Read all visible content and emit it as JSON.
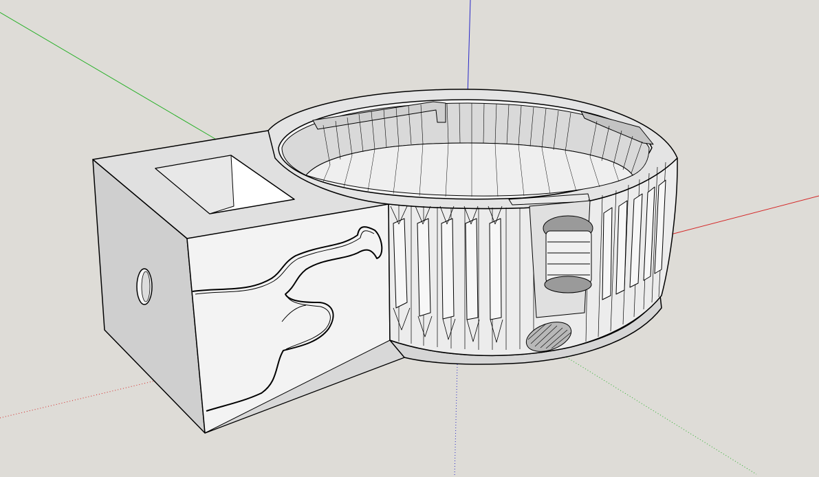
{
  "viewport": {
    "background": "#dedcd7"
  },
  "axes": {
    "red": "#d42424",
    "green": "#26b026",
    "blue": "#2626c8"
  },
  "model": {
    "face_light": "#f2f2f2",
    "face_mid": "#e1e1e1",
    "face_dark": "#cbcbcb",
    "face_darker": "#b5b5b5",
    "edge": "#000000"
  }
}
